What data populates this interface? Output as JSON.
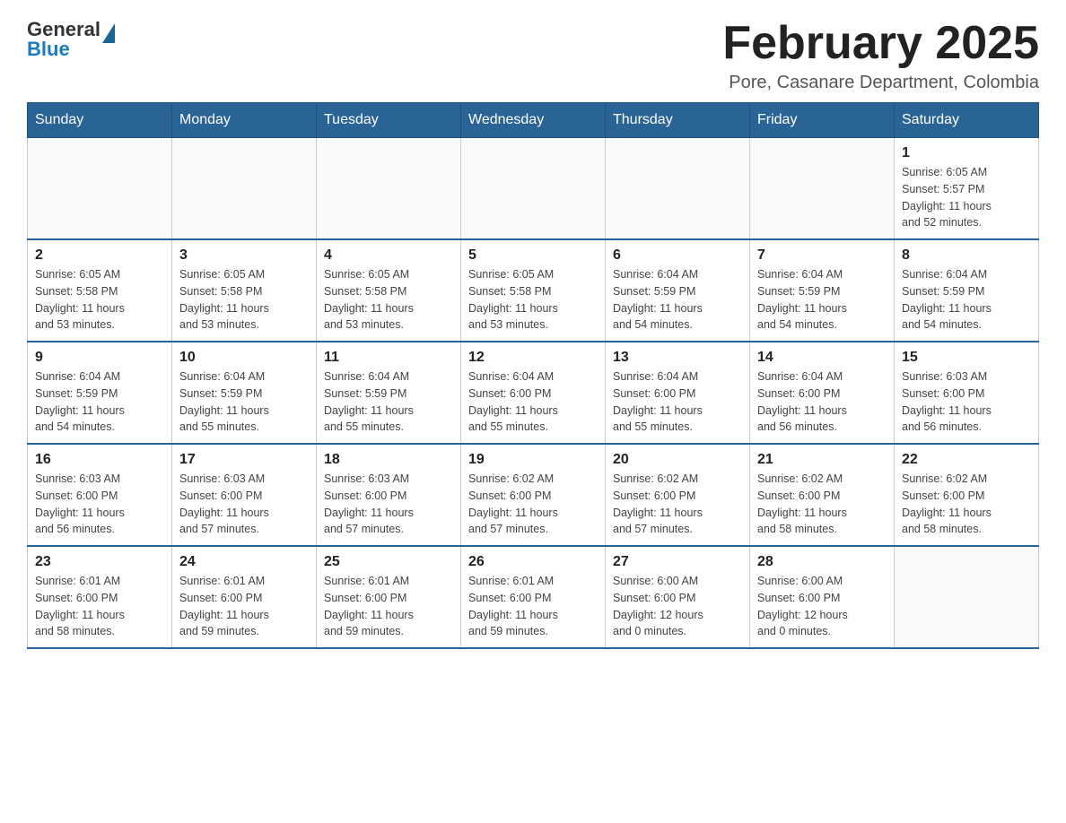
{
  "header": {
    "logo_general": "General",
    "logo_blue": "Blue",
    "title": "February 2025",
    "subtitle": "Pore, Casanare Department, Colombia"
  },
  "days_of_week": [
    "Sunday",
    "Monday",
    "Tuesday",
    "Wednesday",
    "Thursday",
    "Friday",
    "Saturday"
  ],
  "weeks": [
    [
      {
        "day": "",
        "info": ""
      },
      {
        "day": "",
        "info": ""
      },
      {
        "day": "",
        "info": ""
      },
      {
        "day": "",
        "info": ""
      },
      {
        "day": "",
        "info": ""
      },
      {
        "day": "",
        "info": ""
      },
      {
        "day": "1",
        "info": "Sunrise: 6:05 AM\nSunset: 5:57 PM\nDaylight: 11 hours\nand 52 minutes."
      }
    ],
    [
      {
        "day": "2",
        "info": "Sunrise: 6:05 AM\nSunset: 5:58 PM\nDaylight: 11 hours\nand 53 minutes."
      },
      {
        "day": "3",
        "info": "Sunrise: 6:05 AM\nSunset: 5:58 PM\nDaylight: 11 hours\nand 53 minutes."
      },
      {
        "day": "4",
        "info": "Sunrise: 6:05 AM\nSunset: 5:58 PM\nDaylight: 11 hours\nand 53 minutes."
      },
      {
        "day": "5",
        "info": "Sunrise: 6:05 AM\nSunset: 5:58 PM\nDaylight: 11 hours\nand 53 minutes."
      },
      {
        "day": "6",
        "info": "Sunrise: 6:04 AM\nSunset: 5:59 PM\nDaylight: 11 hours\nand 54 minutes."
      },
      {
        "day": "7",
        "info": "Sunrise: 6:04 AM\nSunset: 5:59 PM\nDaylight: 11 hours\nand 54 minutes."
      },
      {
        "day": "8",
        "info": "Sunrise: 6:04 AM\nSunset: 5:59 PM\nDaylight: 11 hours\nand 54 minutes."
      }
    ],
    [
      {
        "day": "9",
        "info": "Sunrise: 6:04 AM\nSunset: 5:59 PM\nDaylight: 11 hours\nand 54 minutes."
      },
      {
        "day": "10",
        "info": "Sunrise: 6:04 AM\nSunset: 5:59 PM\nDaylight: 11 hours\nand 55 minutes."
      },
      {
        "day": "11",
        "info": "Sunrise: 6:04 AM\nSunset: 5:59 PM\nDaylight: 11 hours\nand 55 minutes."
      },
      {
        "day": "12",
        "info": "Sunrise: 6:04 AM\nSunset: 6:00 PM\nDaylight: 11 hours\nand 55 minutes."
      },
      {
        "day": "13",
        "info": "Sunrise: 6:04 AM\nSunset: 6:00 PM\nDaylight: 11 hours\nand 55 minutes."
      },
      {
        "day": "14",
        "info": "Sunrise: 6:04 AM\nSunset: 6:00 PM\nDaylight: 11 hours\nand 56 minutes."
      },
      {
        "day": "15",
        "info": "Sunrise: 6:03 AM\nSunset: 6:00 PM\nDaylight: 11 hours\nand 56 minutes."
      }
    ],
    [
      {
        "day": "16",
        "info": "Sunrise: 6:03 AM\nSunset: 6:00 PM\nDaylight: 11 hours\nand 56 minutes."
      },
      {
        "day": "17",
        "info": "Sunrise: 6:03 AM\nSunset: 6:00 PM\nDaylight: 11 hours\nand 57 minutes."
      },
      {
        "day": "18",
        "info": "Sunrise: 6:03 AM\nSunset: 6:00 PM\nDaylight: 11 hours\nand 57 minutes."
      },
      {
        "day": "19",
        "info": "Sunrise: 6:02 AM\nSunset: 6:00 PM\nDaylight: 11 hours\nand 57 minutes."
      },
      {
        "day": "20",
        "info": "Sunrise: 6:02 AM\nSunset: 6:00 PM\nDaylight: 11 hours\nand 57 minutes."
      },
      {
        "day": "21",
        "info": "Sunrise: 6:02 AM\nSunset: 6:00 PM\nDaylight: 11 hours\nand 58 minutes."
      },
      {
        "day": "22",
        "info": "Sunrise: 6:02 AM\nSunset: 6:00 PM\nDaylight: 11 hours\nand 58 minutes."
      }
    ],
    [
      {
        "day": "23",
        "info": "Sunrise: 6:01 AM\nSunset: 6:00 PM\nDaylight: 11 hours\nand 58 minutes."
      },
      {
        "day": "24",
        "info": "Sunrise: 6:01 AM\nSunset: 6:00 PM\nDaylight: 11 hours\nand 59 minutes."
      },
      {
        "day": "25",
        "info": "Sunrise: 6:01 AM\nSunset: 6:00 PM\nDaylight: 11 hours\nand 59 minutes."
      },
      {
        "day": "26",
        "info": "Sunrise: 6:01 AM\nSunset: 6:00 PM\nDaylight: 11 hours\nand 59 minutes."
      },
      {
        "day": "27",
        "info": "Sunrise: 6:00 AM\nSunset: 6:00 PM\nDaylight: 12 hours\nand 0 minutes."
      },
      {
        "day": "28",
        "info": "Sunrise: 6:00 AM\nSunset: 6:00 PM\nDaylight: 12 hours\nand 0 minutes."
      },
      {
        "day": "",
        "info": ""
      }
    ]
  ]
}
